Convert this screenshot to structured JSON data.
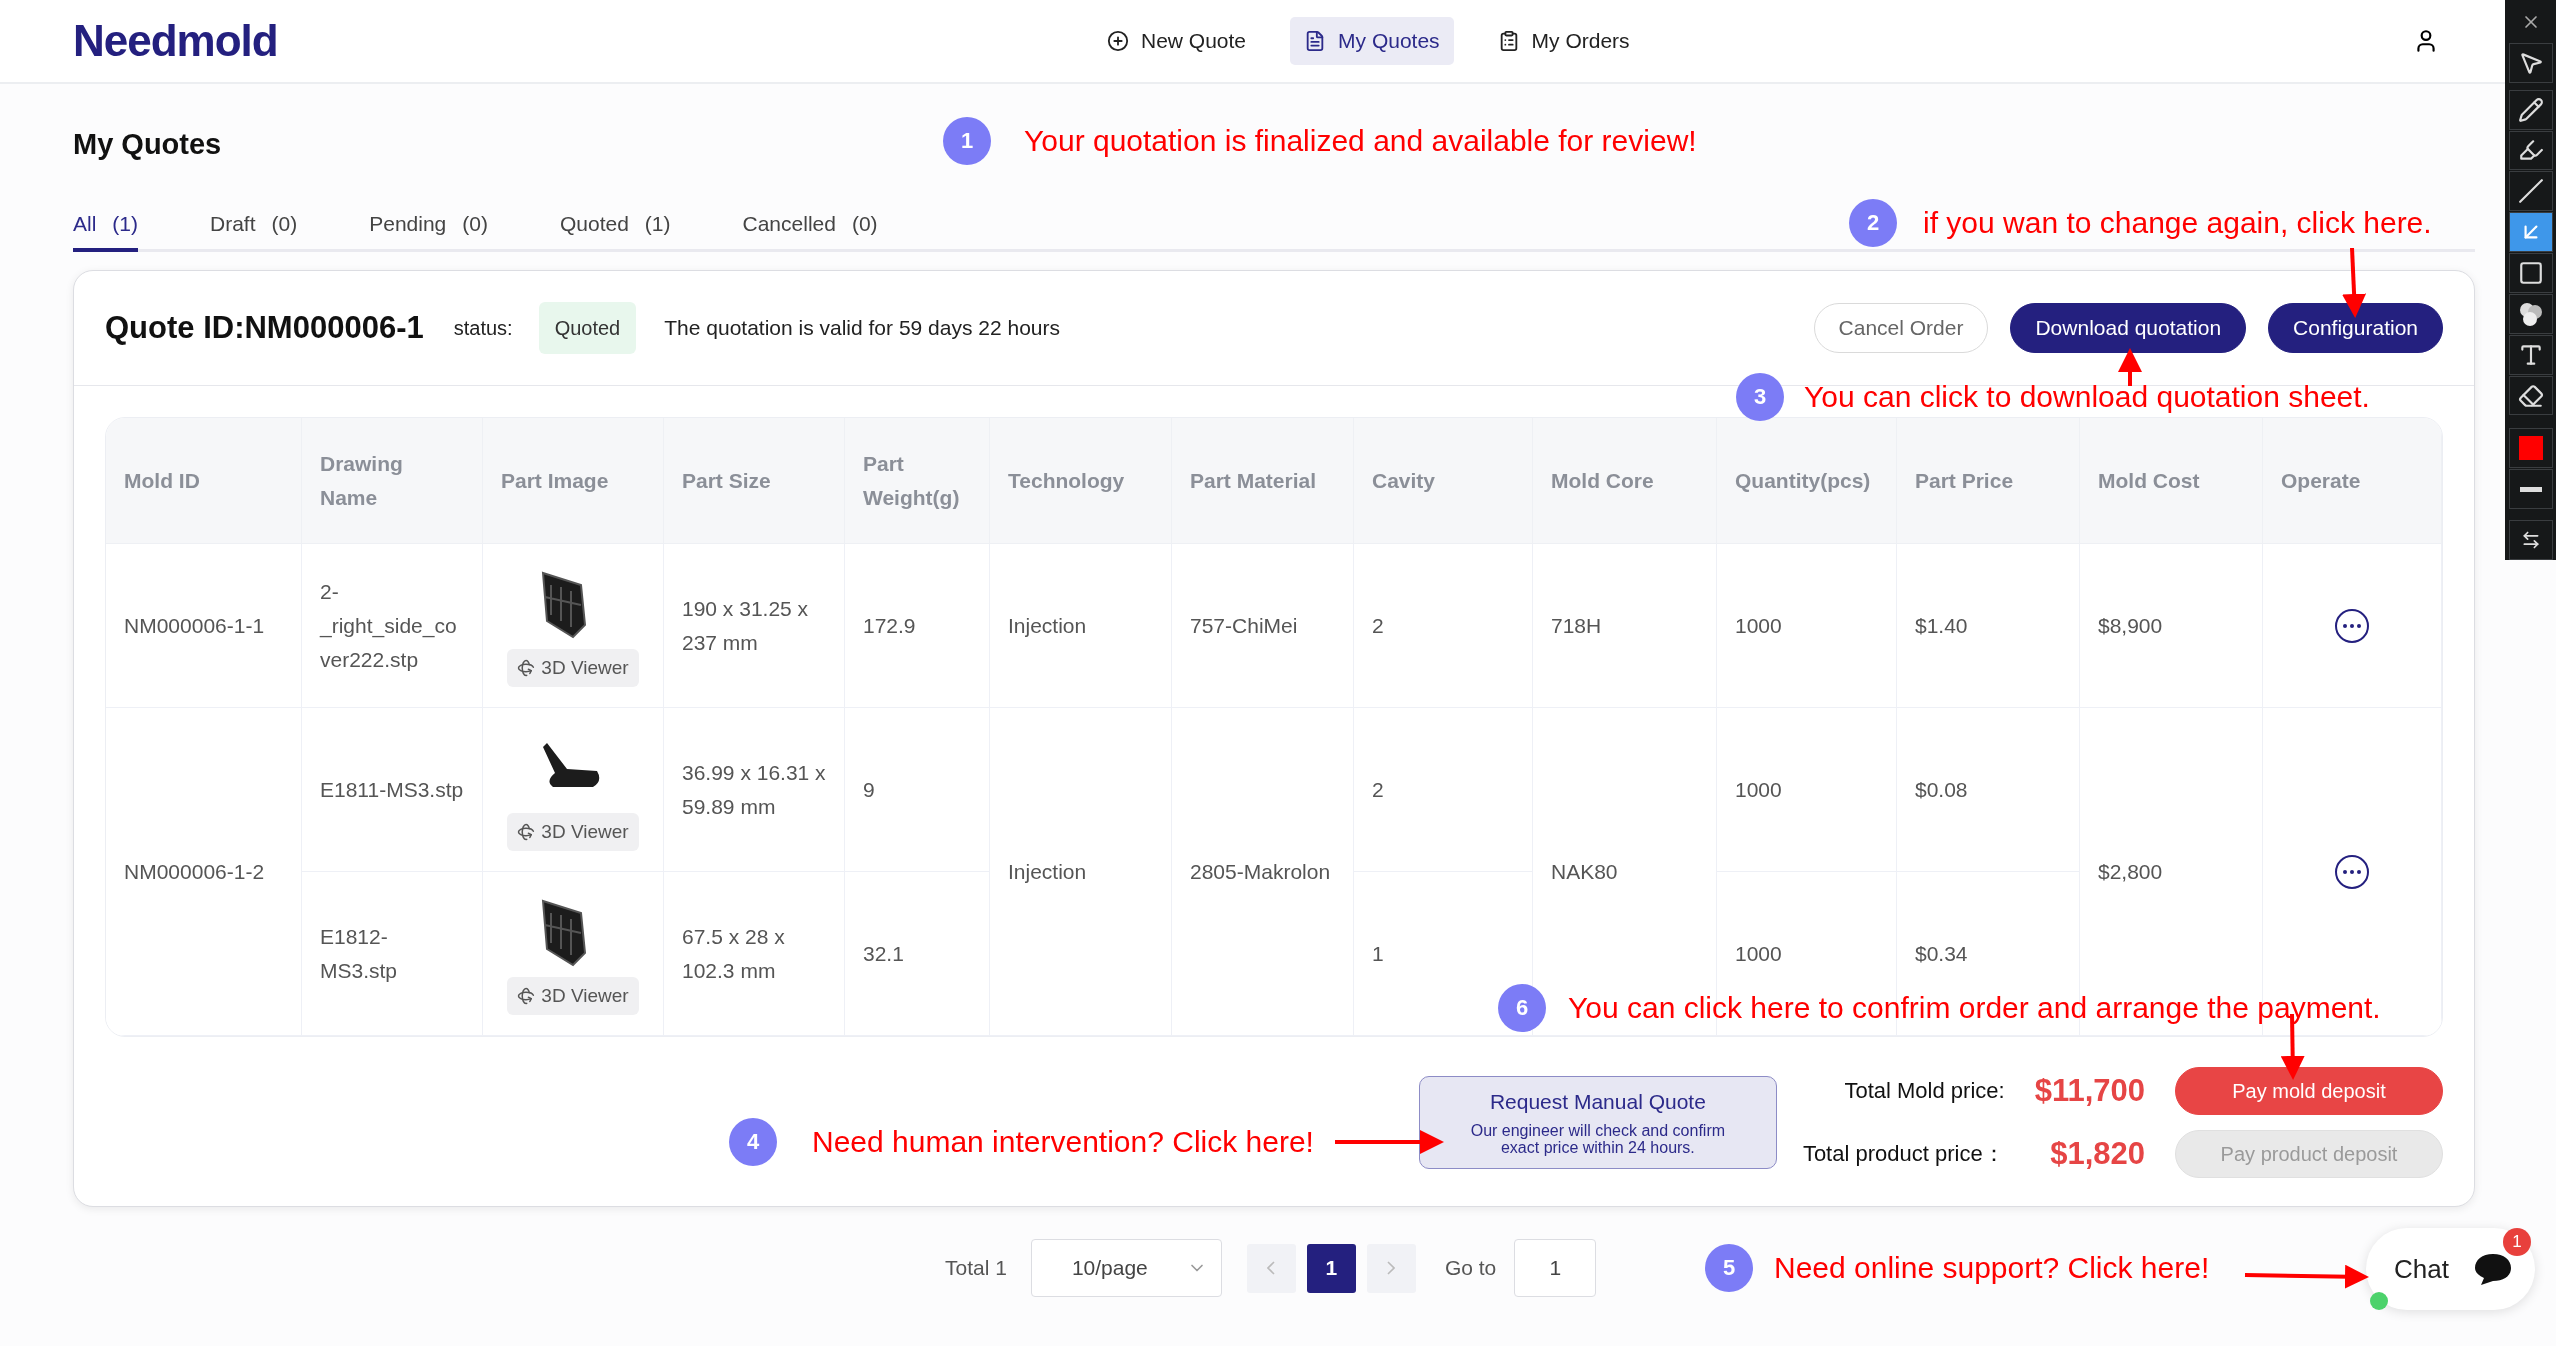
{
  "header": {
    "logo": "Needmold",
    "nav": [
      {
        "label": "New Quote",
        "selected": false
      },
      {
        "label": "My Quotes",
        "selected": true
      },
      {
        "label": "My Orders",
        "selected": false
      }
    ]
  },
  "page_title": "My Quotes",
  "tabs": [
    {
      "label": "All",
      "count": "(1)",
      "selected": true
    },
    {
      "label": "Draft",
      "count": "(0)",
      "selected": false
    },
    {
      "label": "Pending",
      "count": "(0)",
      "selected": false
    },
    {
      "label": "Quoted",
      "count": "(1)",
      "selected": false
    },
    {
      "label": "Cancelled",
      "count": "(0)",
      "selected": false
    }
  ],
  "quote": {
    "id_label": "Quote ID:NM000006-1",
    "status_label": "status:",
    "status": "Quoted",
    "validity": "The quotation is valid for 59 days 22 hours",
    "actions": [
      {
        "label": "Cancel Order",
        "kind": "outline"
      },
      {
        "label": "Download quotation",
        "kind": "primary"
      },
      {
        "label": "Configuration",
        "kind": "primary"
      }
    ]
  },
  "table": {
    "columns": [
      "Mold ID",
      "Drawing Name",
      "Part Image",
      "Part Size",
      "Part Weight(g)",
      "Technology",
      "Part Material",
      "Cavity",
      "Mold Core",
      "Quantity(pcs)",
      "Part Price",
      "Mold Cost",
      "Operate"
    ],
    "molds": [
      {
        "mold_id": "NM000006-1-1",
        "technology": "Injection",
        "material": "757-ChiMei",
        "mold_core": "718H",
        "mold_cost": "$8,900",
        "parts": [
          {
            "drawing_name": "2-_right_side_cover222.stp",
            "viewer": "3D Viewer",
            "size": "190 x 31.25 x 237 mm",
            "weight": "172.9",
            "cavity": "2",
            "quantity": "1000",
            "price": "$1.40"
          }
        ]
      },
      {
        "mold_id": "NM000006-1-2",
        "technology": "Injection",
        "material": "2805-Makrolon",
        "mold_core": "NAK80",
        "mold_cost": "$2,800",
        "parts": [
          {
            "drawing_name": "E1811-MS3.stp",
            "viewer": "3D Viewer",
            "size": "36.99 x 16.31 x 59.89 mm",
            "weight": "9",
            "cavity": "2",
            "quantity": "1000",
            "price": "$0.08"
          },
          {
            "drawing_name": "E1812-MS3.stp",
            "viewer": "3D Viewer",
            "size": "67.5 x 28 x 102.3 mm",
            "weight": "32.1",
            "cavity": "1",
            "quantity": "1000",
            "price": "$0.34"
          }
        ]
      }
    ]
  },
  "manual_quote": {
    "title": "Request Manual Quote",
    "note": "Our engineer will check and confirm exact price within 24 hours."
  },
  "totals": [
    {
      "label": "Total Mold price:",
      "amount": "$11,700",
      "action": "Pay mold deposit",
      "disabled": false
    },
    {
      "label": "Total product price：",
      "amount": "$1,820",
      "action": "Pay product deposit",
      "disabled": true
    }
  ],
  "pagination": {
    "total": "Total 1",
    "page_size": "10/page",
    "pages": [
      {
        "label": "1",
        "selected": true
      }
    ],
    "goto_label": "Go to",
    "goto_value": "1"
  },
  "chat": {
    "label": "Chat",
    "badge": "1",
    "online": true
  },
  "annotations": [
    {
      "number": "1",
      "text": "Your quotation is finalized and available for review!"
    },
    {
      "number": "2",
      "text": "if you wan to change again, click here."
    },
    {
      "number": "3",
      "text": "You can click to download quotation sheet."
    },
    {
      "number": "6",
      "text": "You can click here to confrim order and arrange the payment."
    },
    {
      "number": "4",
      "text": "Need human intervention? Click here!"
    },
    {
      "number": "5",
      "text": "Need online support? Click here!"
    }
  ],
  "toolbar": {
    "color": "#ff0000",
    "tools": [
      {
        "kind": "select",
        "selected": false
      },
      {
        "kind": "pencil",
        "selected": false
      },
      {
        "kind": "highlighter",
        "selected": false
      },
      {
        "kind": "line",
        "selected": false
      },
      {
        "kind": "arrow",
        "selected": true
      },
      {
        "kind": "rectangle",
        "selected": false
      },
      {
        "kind": "numbers",
        "selected": false
      },
      {
        "kind": "text",
        "selected": false
      },
      {
        "kind": "eraser",
        "selected": false
      }
    ]
  }
}
